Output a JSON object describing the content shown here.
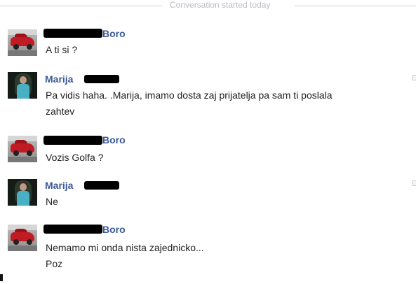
{
  "conversation": {
    "started_label": "Conversation started today"
  },
  "messages": [
    {
      "sender": "Boro",
      "avatar": "car-avatar",
      "lines": [
        "A ti si ?"
      ]
    },
    {
      "sender": "Marija",
      "avatar": "girl-avatar",
      "lines": [
        "Pa vidis haha. .Marija, imamo dosta zaj prijatelja pa sam ti poslala",
        "zahtev"
      ]
    },
    {
      "sender": "Boro",
      "avatar": "car-avatar",
      "lines": [
        "Vozis Golfa ?"
      ]
    },
    {
      "sender": "Marija",
      "avatar": "girl-avatar",
      "lines": [
        "Ne"
      ]
    },
    {
      "sender": "Boro",
      "avatar": "car-avatar",
      "lines": [
        "Nemamo mi onda nista zajednicko...",
        "Poz"
      ]
    }
  ]
}
